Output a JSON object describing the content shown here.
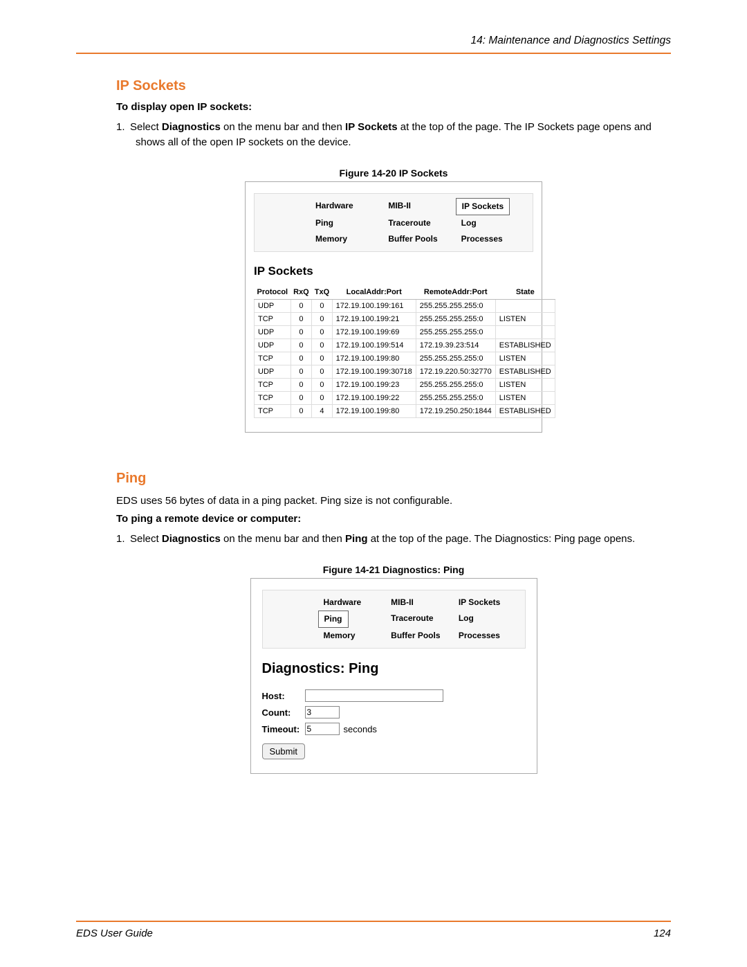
{
  "header": {
    "chapter": "14: Maintenance and Diagnostics Settings"
  },
  "section_ip_sockets": {
    "title": "IP Sockets",
    "subheading": "To display open IP sockets:",
    "step_num": "1.",
    "step_pre": "Select ",
    "step_b1": "Diagnostics",
    "step_mid1": " on the menu bar and then ",
    "step_b2": "IP Sockets",
    "step_post": " at the top of the page. The IP Sockets page opens and shows all of the open IP sockets on the device."
  },
  "figure20": {
    "label": "Figure 14-20  IP Sockets",
    "tabs": {
      "hardware": "Hardware",
      "mib": "MIB-II",
      "ipsockets": "IP Sockets",
      "ping": "Ping",
      "traceroute": "Traceroute",
      "log": "Log",
      "memory": "Memory",
      "buffer": "Buffer Pools",
      "processes": "Processes"
    },
    "panel_title": "IP Sockets",
    "headers": {
      "protocol": "Protocol",
      "rxq": "RxQ",
      "txq": "TxQ",
      "local": "LocalAddr:Port",
      "remote": "RemoteAddr:Port",
      "state": "State"
    },
    "rows": [
      {
        "proto": "UDP",
        "rxq": "0",
        "txq": "0",
        "local": "172.19.100.199:161",
        "remote": "255.255.255.255:0",
        "state": ""
      },
      {
        "proto": "TCP",
        "rxq": "0",
        "txq": "0",
        "local": "172.19.100.199:21",
        "remote": "255.255.255.255:0",
        "state": "LISTEN"
      },
      {
        "proto": "UDP",
        "rxq": "0",
        "txq": "0",
        "local": "172.19.100.199:69",
        "remote": "255.255.255.255:0",
        "state": ""
      },
      {
        "proto": "UDP",
        "rxq": "0",
        "txq": "0",
        "local": "172.19.100.199:514",
        "remote": "172.19.39.23:514",
        "state": "ESTABLISHED"
      },
      {
        "proto": "TCP",
        "rxq": "0",
        "txq": "0",
        "local": "172.19.100.199:80",
        "remote": "255.255.255.255:0",
        "state": "LISTEN"
      },
      {
        "proto": "UDP",
        "rxq": "0",
        "txq": "0",
        "local": "172.19.100.199:30718",
        "remote": "172.19.220.50:32770",
        "state": "ESTABLISHED"
      },
      {
        "proto": "TCP",
        "rxq": "0",
        "txq": "0",
        "local": "172.19.100.199:23",
        "remote": "255.255.255.255:0",
        "state": "LISTEN"
      },
      {
        "proto": "TCP",
        "rxq": "0",
        "txq": "0",
        "local": "172.19.100.199:22",
        "remote": "255.255.255.255:0",
        "state": "LISTEN"
      },
      {
        "proto": "TCP",
        "rxq": "0",
        "txq": "4",
        "local": "172.19.100.199:80",
        "remote": "172.19.250.250:1844",
        "state": "ESTABLISHED"
      }
    ]
  },
  "section_ping": {
    "title": "Ping",
    "intro": "EDS uses 56 bytes of data in a ping packet.  Ping size is not configurable.",
    "subheading": "To ping a remote device or computer:",
    "step_num": "1.",
    "step_pre": "Select ",
    "step_b1": "Diagnostics",
    "step_mid1": " on the menu bar and then ",
    "step_b2": "Ping",
    "step_post": " at the top of the page. The Diagnostics: Ping page opens."
  },
  "figure21": {
    "label": "Figure 14-21  Diagnostics: Ping",
    "tabs": {
      "hardware": "Hardware",
      "mib": "MIB-II",
      "ipsockets": "IP Sockets",
      "ping": "Ping",
      "traceroute": "Traceroute",
      "log": "Log",
      "memory": "Memory",
      "buffer": "Buffer Pools",
      "processes": "Processes"
    },
    "panel_title": "Diagnostics: Ping",
    "form": {
      "host_label": "Host:",
      "host_value": "",
      "count_label": "Count:",
      "count_value": "3",
      "timeout_label": "Timeout:",
      "timeout_value": "5",
      "timeout_unit": "seconds",
      "submit": "Submit"
    }
  },
  "footer": {
    "guide": "EDS User Guide",
    "page": "124"
  }
}
